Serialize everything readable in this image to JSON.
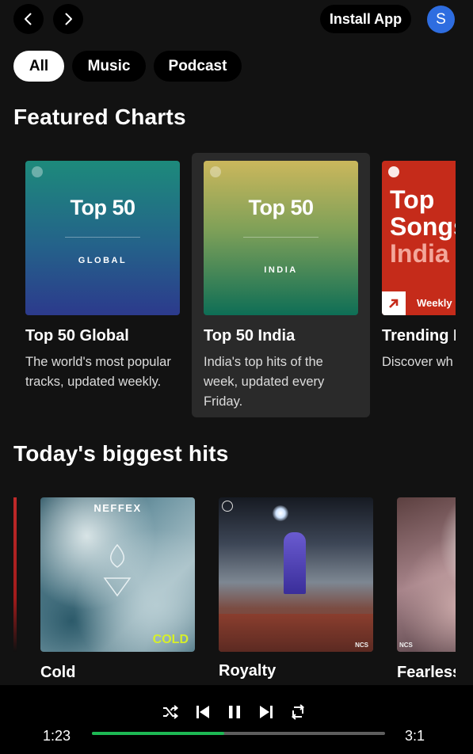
{
  "topbar": {
    "back_icon": "chevron-left-icon",
    "forward_icon": "chevron-right-icon",
    "install_label": "Install App",
    "avatar_initial": "S"
  },
  "filters": {
    "chips": [
      {
        "label": "All",
        "active": true
      },
      {
        "label": "Music",
        "active": false
      },
      {
        "label": "Podcast",
        "active": false
      }
    ]
  },
  "featured": {
    "title": "Featured Charts",
    "cards": [
      {
        "cover_title": "Top 50",
        "cover_sub": "GLOBAL",
        "title": "Top 50 Global",
        "desc": "The world's most popular tracks, updated weekly.",
        "gradient": [
          "#1e8a7a",
          "#2b3a8a"
        ]
      },
      {
        "cover_title": "Top 50",
        "cover_sub": "INDIA",
        "title": "Top 50 India",
        "desc": "India's top hits of the week, updated every Friday.",
        "gradient": [
          "#c9b45c",
          "#0f6e55"
        ]
      },
      {
        "cover_lines": [
          "Top",
          "Songs",
          "India"
        ],
        "cover_badge": "Weekly",
        "title": "Trending I",
        "desc": "Discover wh across India",
        "color": "#c52b1a"
      }
    ]
  },
  "hits": {
    "title": "Today's biggest hits",
    "tracks": [
      {
        "title": "Cold",
        "cover_text": "NEFFEX",
        "cover_tag": "COLD"
      },
      {
        "title": "Royalty",
        "cover_tag": "NCS"
      },
      {
        "title": "Fearless",
        "cover_tag": "NCS"
      }
    ]
  },
  "player": {
    "elapsed": "1:23",
    "duration": "3:1",
    "progress": 0.45,
    "controls": [
      "shuffle-icon",
      "previous-icon",
      "pause-icon",
      "next-icon",
      "repeat-icon"
    ]
  },
  "colors": {
    "background": "#121212",
    "accent": "#1db954",
    "avatar": "#2e6de0"
  }
}
